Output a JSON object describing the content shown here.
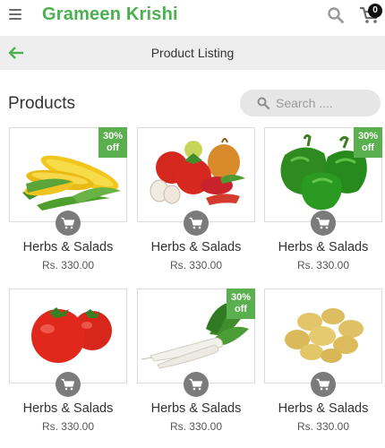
{
  "header": {
    "app_title": "Grameen Krishi",
    "cart_count": "0"
  },
  "subheader": {
    "title": "Product Listing"
  },
  "section": {
    "title": "Products"
  },
  "search": {
    "placeholder": "Search ...."
  },
  "colors": {
    "brand": "#4cb050",
    "badge": "#5ab04e",
    "cart_button": "#7b7b7b",
    "subheader_bg": "#eeeeee"
  },
  "products": [
    {
      "name": "Herbs & Salads",
      "price": "Rs. 330.00",
      "discount": "30% off",
      "image": "corn"
    },
    {
      "name": "Herbs & Salads",
      "price": "Rs. 330.00",
      "discount": "",
      "image": "mixed-vegetables"
    },
    {
      "name": "Herbs & Salads",
      "price": "Rs. 330.00",
      "discount": "30% off",
      "image": "green-capsicum"
    },
    {
      "name": "Herbs & Salads",
      "price": "Rs. 330.00",
      "discount": "",
      "image": "tomatoes"
    },
    {
      "name": "Herbs & Salads",
      "price": "Rs. 330.00",
      "discount": "30% off",
      "image": "radish"
    },
    {
      "name": "Herbs & Salads",
      "price": "Rs. 330.00",
      "discount": "",
      "image": "potatoes"
    }
  ]
}
